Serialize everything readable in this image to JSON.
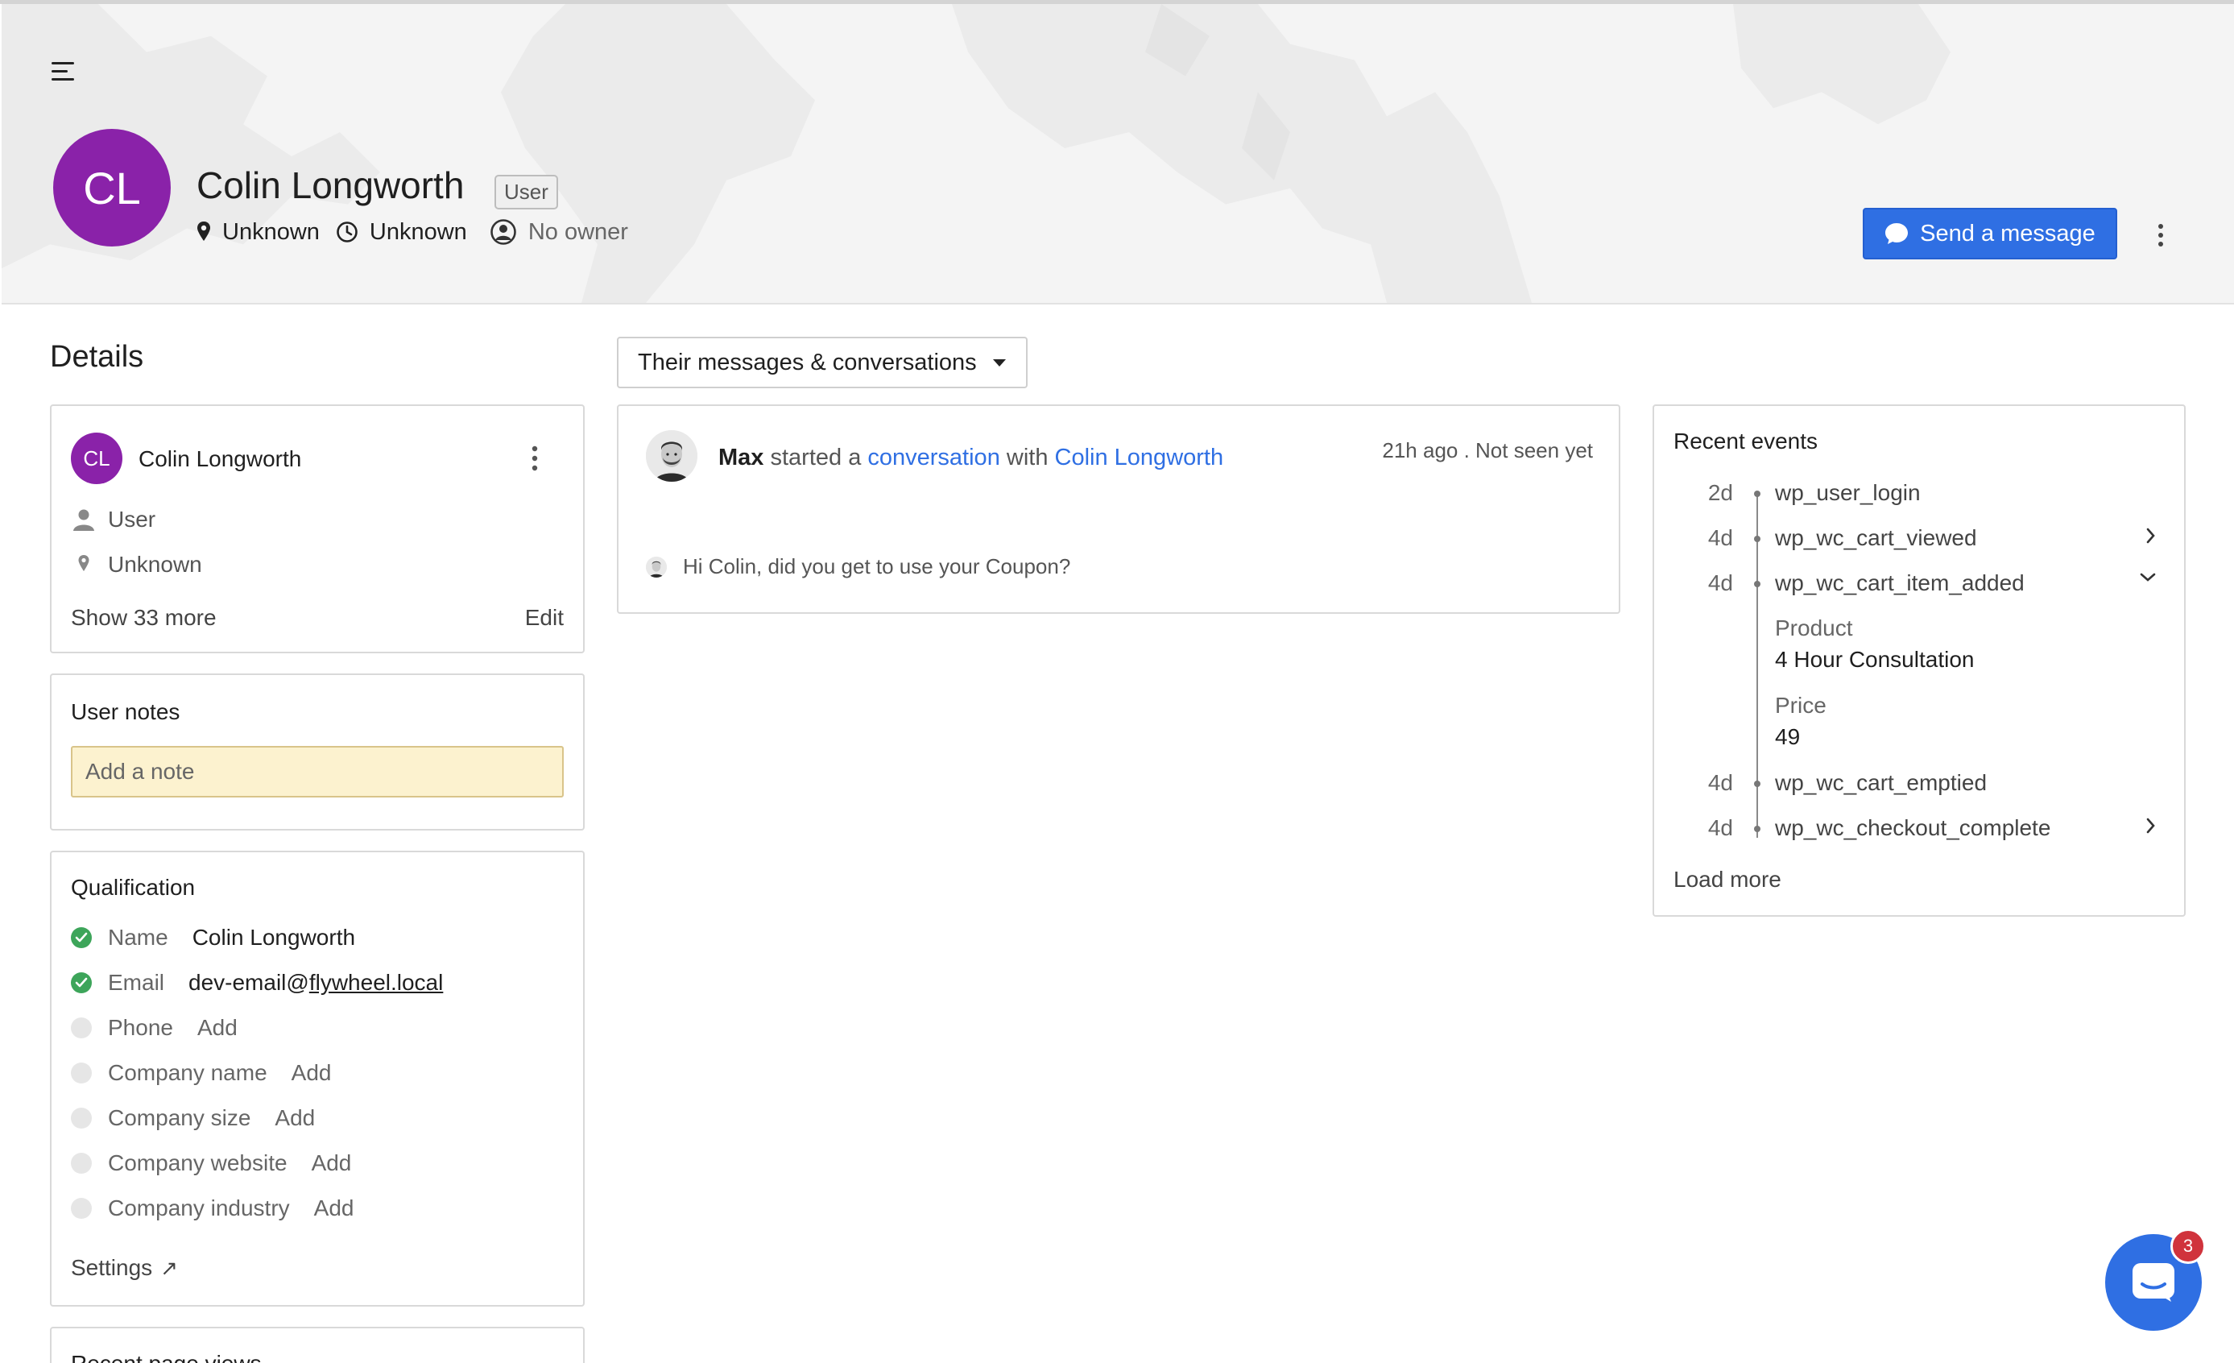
{
  "header": {
    "avatar_initials": "CL",
    "user_name": "Colin Longworth",
    "user_tag": "User",
    "location": "Unknown",
    "local_time": "Unknown",
    "owner": "No owner",
    "send_message_label": "Send a message",
    "accent_color": "#2f6fe3",
    "avatar_color": "#8a22a9"
  },
  "details": {
    "title": "Details",
    "contact": {
      "avatar_initials": "CL",
      "name": "Colin Longworth",
      "role": "User",
      "location": "Unknown",
      "show_more": "Show 33 more",
      "edit": "Edit"
    },
    "notes": {
      "title": "User notes",
      "placeholder": "Add a note"
    },
    "qualification": {
      "title": "Qualification",
      "rows": [
        {
          "label": "Name",
          "value": "Colin Longworth",
          "status": "complete"
        },
        {
          "label": "Email",
          "value_prefix": "dev-email@",
          "value_link": "flywheel.local",
          "status": "complete"
        },
        {
          "label": "Phone",
          "value": "Add",
          "status": "empty"
        },
        {
          "label": "Company name",
          "value": "Add",
          "status": "empty"
        },
        {
          "label": "Company size",
          "value": "Add",
          "status": "empty"
        },
        {
          "label": "Company website",
          "value": "Add",
          "status": "empty"
        },
        {
          "label": "Company industry",
          "value": "Add",
          "status": "empty"
        }
      ],
      "settings": "Settings",
      "settings_icon": "external-arrow-icon"
    },
    "page_views": {
      "title": "Recent page views"
    }
  },
  "conversations": {
    "filter_label": "Their messages & conversations",
    "items": [
      {
        "agent": "Max",
        "started_text": "started a",
        "conversation_word": "conversation",
        "with_text": "with",
        "customer": "Colin Longworth",
        "time": "21h ago . Not seen yet",
        "preview": "Hi Colin, did you get to use your Coupon?"
      }
    ]
  },
  "events": {
    "title": "Recent events",
    "items": [
      {
        "age": "2d",
        "name": "wp_user_login",
        "chevron": ""
      },
      {
        "age": "4d",
        "name": "wp_wc_cart_viewed",
        "chevron": "chevron-right-icon"
      },
      {
        "age": "4d",
        "name": "wp_wc_cart_item_added",
        "chevron": "chevron-down-icon",
        "properties": [
          {
            "label": "Product",
            "value": "4 Hour Consultation"
          },
          {
            "label": "Price",
            "value": "49"
          }
        ]
      },
      {
        "age": "4d",
        "name": "wp_wc_cart_emptied",
        "chevron": ""
      },
      {
        "age": "4d",
        "name": "wp_wc_checkout_complete",
        "chevron": "chevron-right-icon"
      }
    ],
    "load_more": "Load more"
  },
  "launcher": {
    "badge_count": "3"
  }
}
